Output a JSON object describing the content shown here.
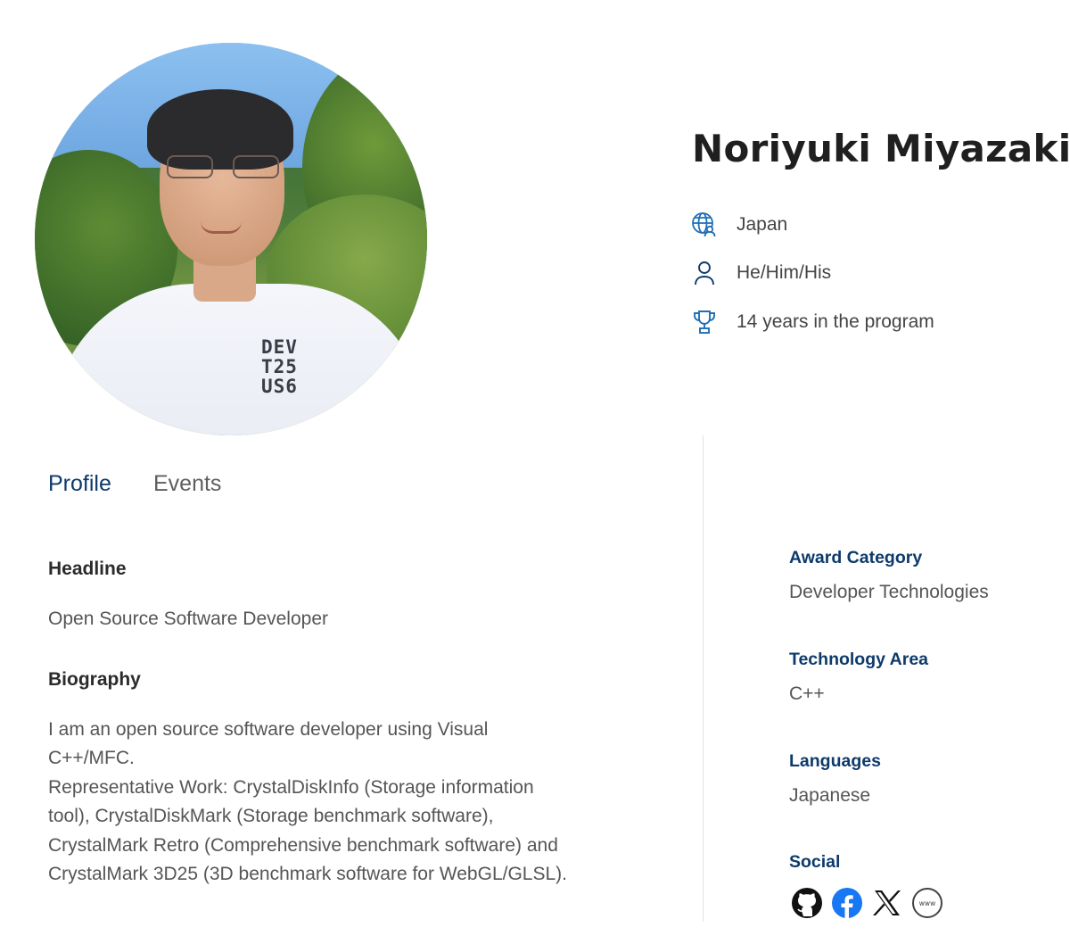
{
  "profile": {
    "name": "Noriyuki Miyazaki",
    "shirt_print": [
      "DEV",
      "T25",
      "US6"
    ],
    "meta": [
      {
        "icon": "globe-person-icon",
        "text": "Japan"
      },
      {
        "icon": "person-icon",
        "text": "He/Him/His"
      },
      {
        "icon": "trophy-icon",
        "text": "14 years in the program"
      }
    ]
  },
  "tabs": [
    {
      "label": "Profile",
      "active": true
    },
    {
      "label": "Events",
      "active": false
    }
  ],
  "main": {
    "headline_title": "Headline",
    "headline_text": "Open Source Software Developer",
    "biography_title": "Biography",
    "biography_lines": [
      "I am an open source software developer using Visual",
      "C++/MFC.",
      "Representative Work: CrystalDiskInfo (Storage information",
      "tool), CrystalDiskMark (Storage benchmark software),",
      "CrystalMark Retro (Comprehensive benchmark software) and",
      "CrystalMark 3D25 (3D benchmark software for WebGL/GLSL)."
    ]
  },
  "sidebar": {
    "award_category_title": "Award Category",
    "award_category_value": "Developer Technologies",
    "technology_area_title": "Technology Area",
    "technology_area_value": "C++",
    "languages_title": "Languages",
    "languages_value": "Japanese",
    "social_title": "Social",
    "social_links": [
      {
        "icon": "github-icon"
      },
      {
        "icon": "facebook-icon"
      },
      {
        "icon": "x-icon"
      },
      {
        "icon": "website-icon",
        "text": "www"
      }
    ]
  },
  "colors": {
    "accent": "#0e3a6b",
    "icon_blue": "#1f6fb5",
    "facebook_blue": "#1877f2"
  }
}
